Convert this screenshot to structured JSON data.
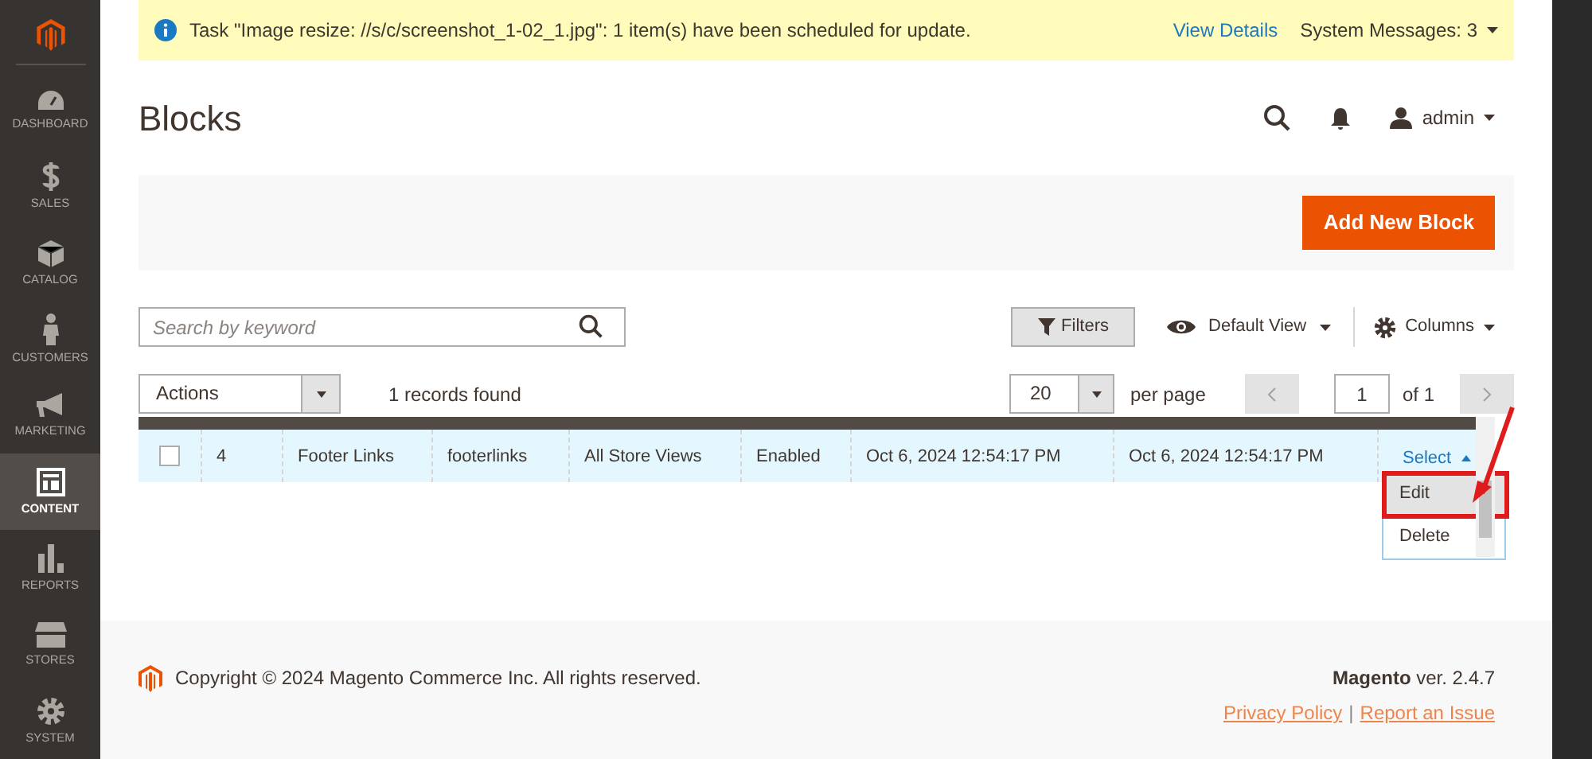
{
  "sidebar": {
    "items": [
      {
        "kind": "dashboard",
        "label": "DASHBOARD",
        "selected": false
      },
      {
        "kind": "sales",
        "label": "SALES",
        "selected": false
      },
      {
        "kind": "catalog",
        "label": "CATALOG",
        "selected": false
      },
      {
        "kind": "customers",
        "label": "CUSTOMERS",
        "selected": false
      },
      {
        "kind": "marketing",
        "label": "MARKETING",
        "selected": false
      },
      {
        "kind": "content",
        "label": "CONTENT",
        "selected": true
      },
      {
        "kind": "reports",
        "label": "REPORTS",
        "selected": false
      },
      {
        "kind": "stores",
        "label": "STORES",
        "selected": false
      },
      {
        "kind": "system",
        "label": "SYSTEM",
        "selected": false
      }
    ]
  },
  "notice": {
    "message": "Task \"Image resize: //s/c/screenshot_1-02_1.jpg\": 1 item(s) have been scheduled for update.",
    "link": "View Details",
    "system_messages": "System Messages: 3"
  },
  "header": {
    "title": "Blocks",
    "user": "admin"
  },
  "actions": {
    "add_button": "Add New Block"
  },
  "toolbar": {
    "search_placeholder": "Search by keyword",
    "filters": "Filters",
    "view": "Default View",
    "columns": "Columns"
  },
  "grid": {
    "mass_action": "Actions",
    "records": "1 records found",
    "per_page_value": "20",
    "per_page_label": "per page",
    "page": "1",
    "page_total": "of 1",
    "rows": [
      {
        "selected": false,
        "cells": [
          "4",
          "Footer Links",
          "footerlinks",
          "All Store Views",
          "Enabled",
          "Oct 6, 2024 12:54:17 PM",
          "Oct 6, 2024 12:54:17 PM"
        ],
        "action": "Select",
        "menu_open": true,
        "menu": [
          {
            "label": "Edit",
            "highlighted": true
          },
          {
            "label": "Delete",
            "highlighted": false
          }
        ]
      }
    ]
  },
  "footer": {
    "copyright": "Copyright © 2024 Magento Commerce Inc. All rights reserved.",
    "version": "**Magento** ver. 2.4.7",
    "links": [
      "Privacy Policy",
      "Report an Issue"
    ],
    "link_separator": "|"
  }
}
